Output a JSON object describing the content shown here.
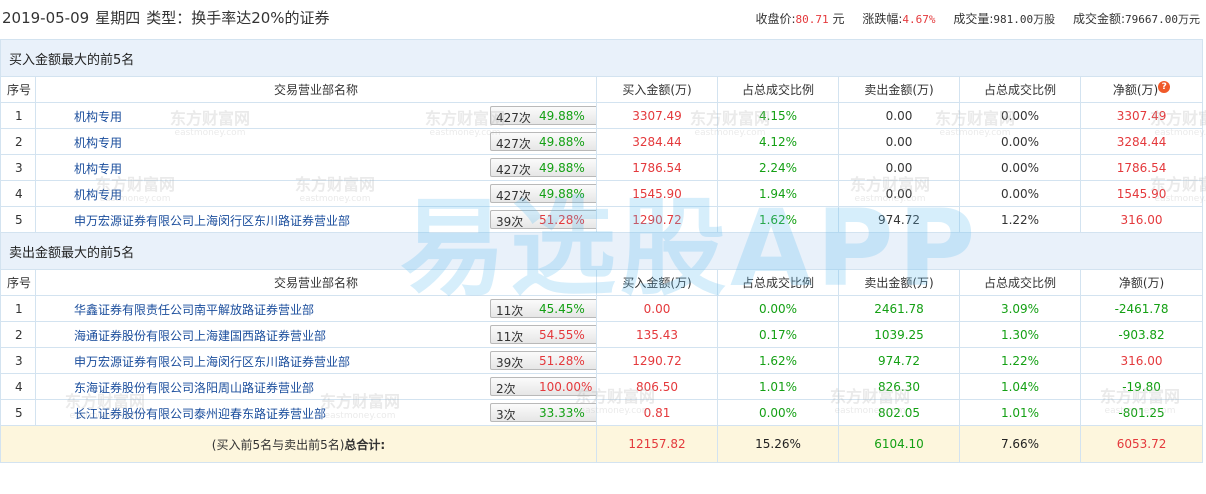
{
  "header": {
    "date": "2019-05-09",
    "weekday": "星期四",
    "type_label": "类型：换手率达20%的证券",
    "close_label": "收盘价:",
    "close_value": "80.71",
    "close_unit": "元",
    "change_label": "涨跌幅:",
    "change_value": "4.67%",
    "volume_label": "成交量:",
    "volume_value": "981.00万股",
    "amount_label": "成交金额:",
    "amount_value": "79667.00万元"
  },
  "columns": {
    "index": "序号",
    "broker": "交易营业部名称",
    "buy": "买入金额(万)",
    "buy_ratio": "占总成交比例",
    "sell": "卖出金额(万)",
    "sell_ratio": "占总成交比例",
    "net": "净额(万)"
  },
  "buy_section": {
    "title": "买入金额最大的前5名",
    "rows": [
      {
        "idx": "1",
        "broker": "机构专用",
        "count": "427次",
        "rate": "49.88%",
        "rate_color": "green",
        "buy": "3307.49",
        "buy_ratio": "4.15%",
        "sell": "0.00",
        "sell_ratio": "0.00%",
        "net": "3307.49",
        "net_color": "red",
        "help": true
      },
      {
        "idx": "2",
        "broker": "机构专用",
        "count": "427次",
        "rate": "49.88%",
        "rate_color": "green",
        "buy": "3284.44",
        "buy_ratio": "4.12%",
        "sell": "0.00",
        "sell_ratio": "0.00%",
        "net": "3284.44",
        "net_color": "red",
        "help": false
      },
      {
        "idx": "3",
        "broker": "机构专用",
        "count": "427次",
        "rate": "49.88%",
        "rate_color": "green",
        "buy": "1786.54",
        "buy_ratio": "2.24%",
        "sell": "0.00",
        "sell_ratio": "0.00%",
        "net": "1786.54",
        "net_color": "red",
        "help": false
      },
      {
        "idx": "4",
        "broker": "机构专用",
        "count": "427次",
        "rate": "49.88%",
        "rate_color": "green",
        "buy": "1545.90",
        "buy_ratio": "1.94%",
        "sell": "0.00",
        "sell_ratio": "0.00%",
        "net": "1545.90",
        "net_color": "red",
        "help": false
      },
      {
        "idx": "5",
        "broker": "申万宏源证券有限公司上海闵行区东川路证券营业部",
        "count": "39次",
        "rate": "51.28%",
        "rate_color": "red",
        "buy": "1290.72",
        "buy_ratio": "1.62%",
        "sell": "974.72",
        "sell_ratio": "1.22%",
        "net": "316.00",
        "net_color": "red",
        "help": false
      }
    ]
  },
  "sell_section": {
    "title": "卖出金额最大的前5名",
    "rows": [
      {
        "idx": "1",
        "broker": "华鑫证券有限责任公司南平解放路证券营业部",
        "count": "11次",
        "rate": "45.45%",
        "rate_color": "green",
        "buy": "0.00",
        "buy_ratio": "0.00%",
        "sell": "2461.78",
        "sell_ratio": "3.09%",
        "net": "-2461.78",
        "net_color": "green"
      },
      {
        "idx": "2",
        "broker": "海通证券股份有限公司上海建国西路证券营业部",
        "count": "11次",
        "rate": "54.55%",
        "rate_color": "red",
        "buy": "135.43",
        "buy_ratio": "0.17%",
        "sell": "1039.25",
        "sell_ratio": "1.30%",
        "net": "-903.82",
        "net_color": "green"
      },
      {
        "idx": "3",
        "broker": "申万宏源证券有限公司上海闵行区东川路证券营业部",
        "count": "39次",
        "rate": "51.28%",
        "rate_color": "red",
        "buy": "1290.72",
        "buy_ratio": "1.62%",
        "sell": "974.72",
        "sell_ratio": "1.22%",
        "net": "316.00",
        "net_color": "red"
      },
      {
        "idx": "4",
        "broker": "东海证券股份有限公司洛阳周山路证券营业部",
        "count": "2次",
        "rate": "100.00%",
        "rate_color": "red",
        "buy": "806.50",
        "buy_ratio": "1.01%",
        "sell": "826.30",
        "sell_ratio": "1.04%",
        "net": "-19.80",
        "net_color": "green"
      },
      {
        "idx": "5",
        "broker": "长江证券股份有限公司泰州迎春东路证券营业部",
        "count": "3次",
        "rate": "33.33%",
        "rate_color": "green",
        "buy": "0.81",
        "buy_ratio": "0.00%",
        "sell": "802.05",
        "sell_ratio": "1.01%",
        "net": "-801.25",
        "net_color": "green"
      }
    ]
  },
  "summary": {
    "label_prefix": "(买入前5名与卖出前5名)",
    "label_bold": "总合计:",
    "buy": "12157.82",
    "buy_ratio": "15.26%",
    "sell": "6104.10",
    "sell_ratio": "7.66%",
    "net": "6053.72"
  },
  "watermark": {
    "main": "易选股APP",
    "brand": "东方财富网",
    "brand_url": "eastmoney.com"
  },
  "colors": {
    "red": "#e4393c",
    "green": "#14a014",
    "link": "#1a4d9c",
    "section_bg": "#e9f1fa",
    "summary_bg": "#fdf6dd"
  }
}
